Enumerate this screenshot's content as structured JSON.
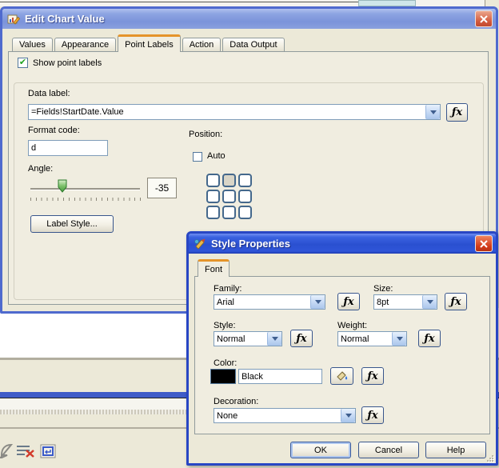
{
  "icons": {
    "check": "✔"
  },
  "edit_chart_dialog": {
    "title": "Edit Chart Value",
    "tabs": [
      {
        "label": "Values"
      },
      {
        "label": "Appearance"
      },
      {
        "label": "Point Labels"
      },
      {
        "label": "Action"
      },
      {
        "label": "Data Output"
      }
    ],
    "active_tab": "Point Labels",
    "show_point_labels_label": "Show point labels",
    "show_point_labels_checked": true,
    "data_label_label": "Data label:",
    "data_label_value": "=Fields!StartDate.Value",
    "format_code_label": "Format code:",
    "format_code_value": "d",
    "position_label": "Position:",
    "auto_label": "Auto",
    "auto_checked": false,
    "position_grid_shaded_cell": 1,
    "angle_label": "Angle:",
    "angle_value": "-35",
    "label_style_button": "Label Style...",
    "fx_button": "ƒx"
  },
  "style_properties_dialog": {
    "title": "Style Properties",
    "font_tab": "Font",
    "family_label": "Family:",
    "family_value": "Arial",
    "size_label": "Size:",
    "size_value": "8pt",
    "style_label": "Style:",
    "style_value": "Normal",
    "weight_label": "Weight:",
    "weight_value": "Normal",
    "color_label": "Color:",
    "color_value": "Black",
    "color_swatch": "#000000",
    "decoration_label": "Decoration:",
    "decoration_value": "None",
    "ok_button": "OK",
    "cancel_button": "Cancel",
    "help_button": "Help",
    "fx_button": "ƒx"
  }
}
